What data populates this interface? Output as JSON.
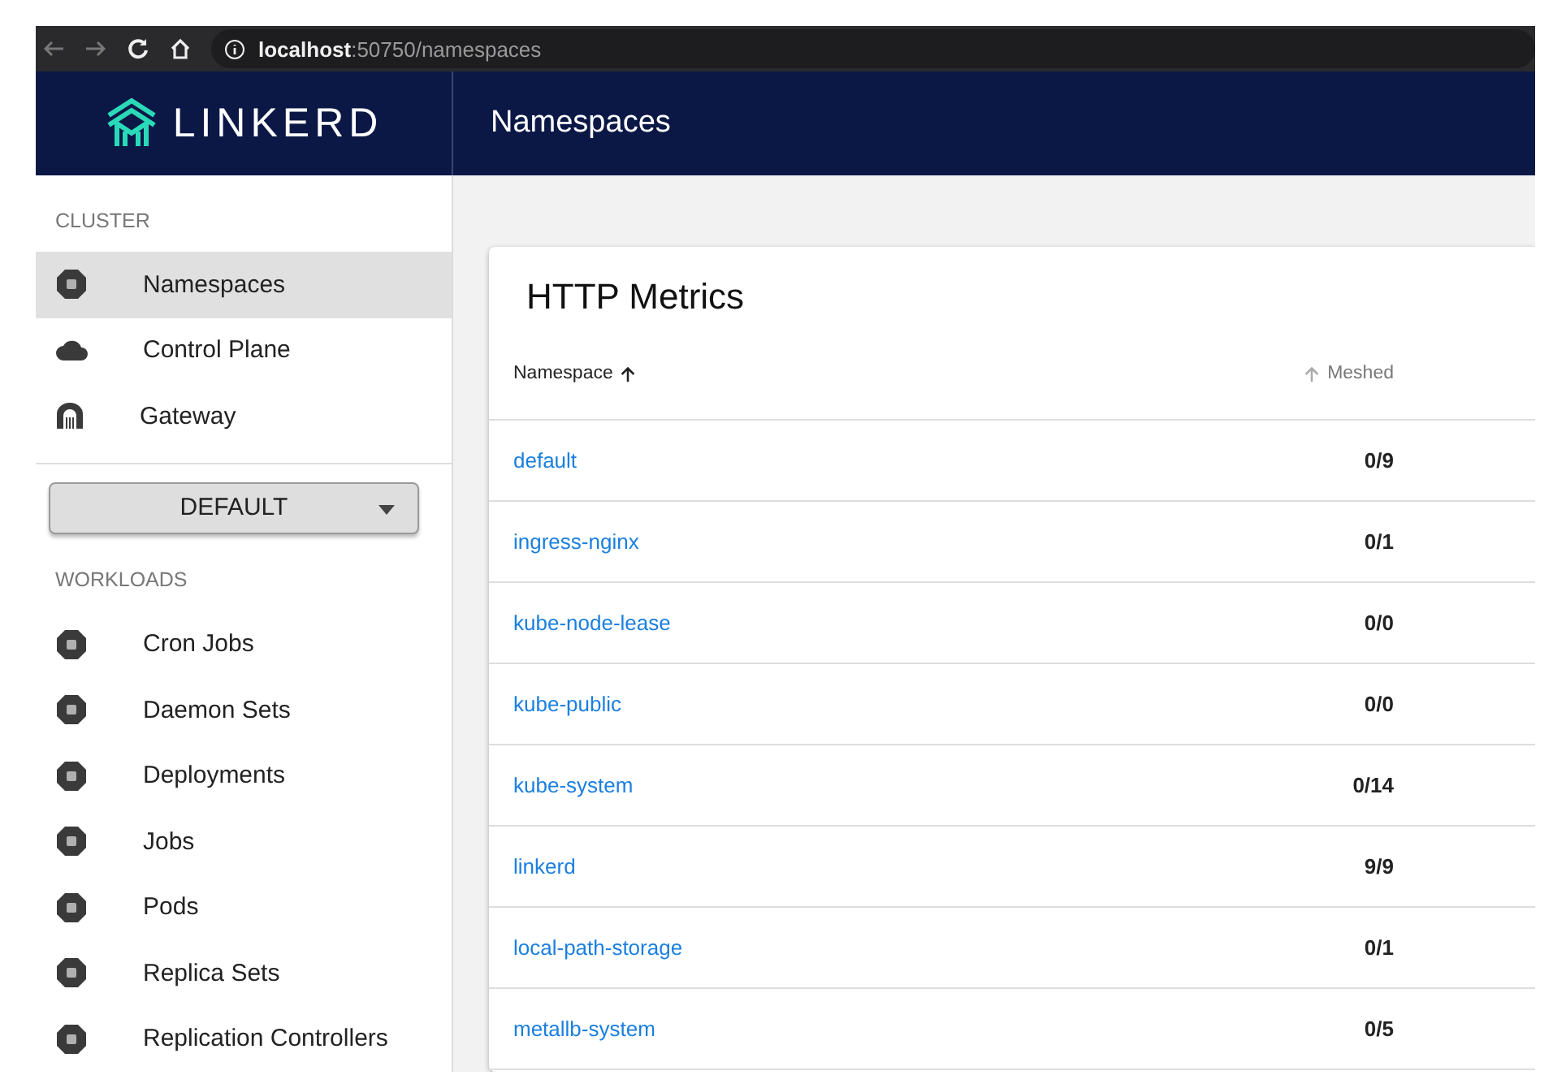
{
  "browser": {
    "url": "**localhost**:50750/namespaces"
  },
  "header": {
    "brand": "LINKERD",
    "title": "Namespaces"
  },
  "sidebar": {
    "sections": [
      {
        "heading": "CLUSTER",
        "items": [
          {
            "label": "Namespaces",
            "selected": true
          },
          {
            "label": "Control Plane",
            "selected": false
          },
          {
            "label": "Gateway",
            "selected": false
          }
        ]
      },
      {
        "heading": "WORKLOADS",
        "items": [
          {
            "label": "Cron Jobs",
            "selected": false
          },
          {
            "label": "Daemon Sets",
            "selected": false
          },
          {
            "label": "Deployments",
            "selected": false
          },
          {
            "label": "Jobs",
            "selected": false
          },
          {
            "label": "Pods",
            "selected": false
          },
          {
            "label": "Replica Sets",
            "selected": false
          },
          {
            "label": "Replication Controllers",
            "selected": false
          }
        ]
      }
    ],
    "namespace_select": "DEFAULT"
  },
  "card": {
    "title": "HTTP Metrics",
    "columns": [
      {
        "label": "Namespace",
        "sorted": true
      },
      {
        "label": "Meshed",
        "sorted": false
      }
    ],
    "rows": [
      {
        "namespace": "default",
        "meshed": "0/9"
      },
      {
        "namespace": "ingress-nginx",
        "meshed": "0/1"
      },
      {
        "namespace": "kube-node-lease",
        "meshed": "0/0"
      },
      {
        "namespace": "kube-public",
        "meshed": "0/0"
      },
      {
        "namespace": "kube-system",
        "meshed": "0/14"
      },
      {
        "namespace": "linkerd",
        "meshed": "9/9"
      },
      {
        "namespace": "local-path-storage",
        "meshed": "0/1"
      },
      {
        "namespace": "metallb-system",
        "meshed": "0/5"
      }
    ]
  }
}
